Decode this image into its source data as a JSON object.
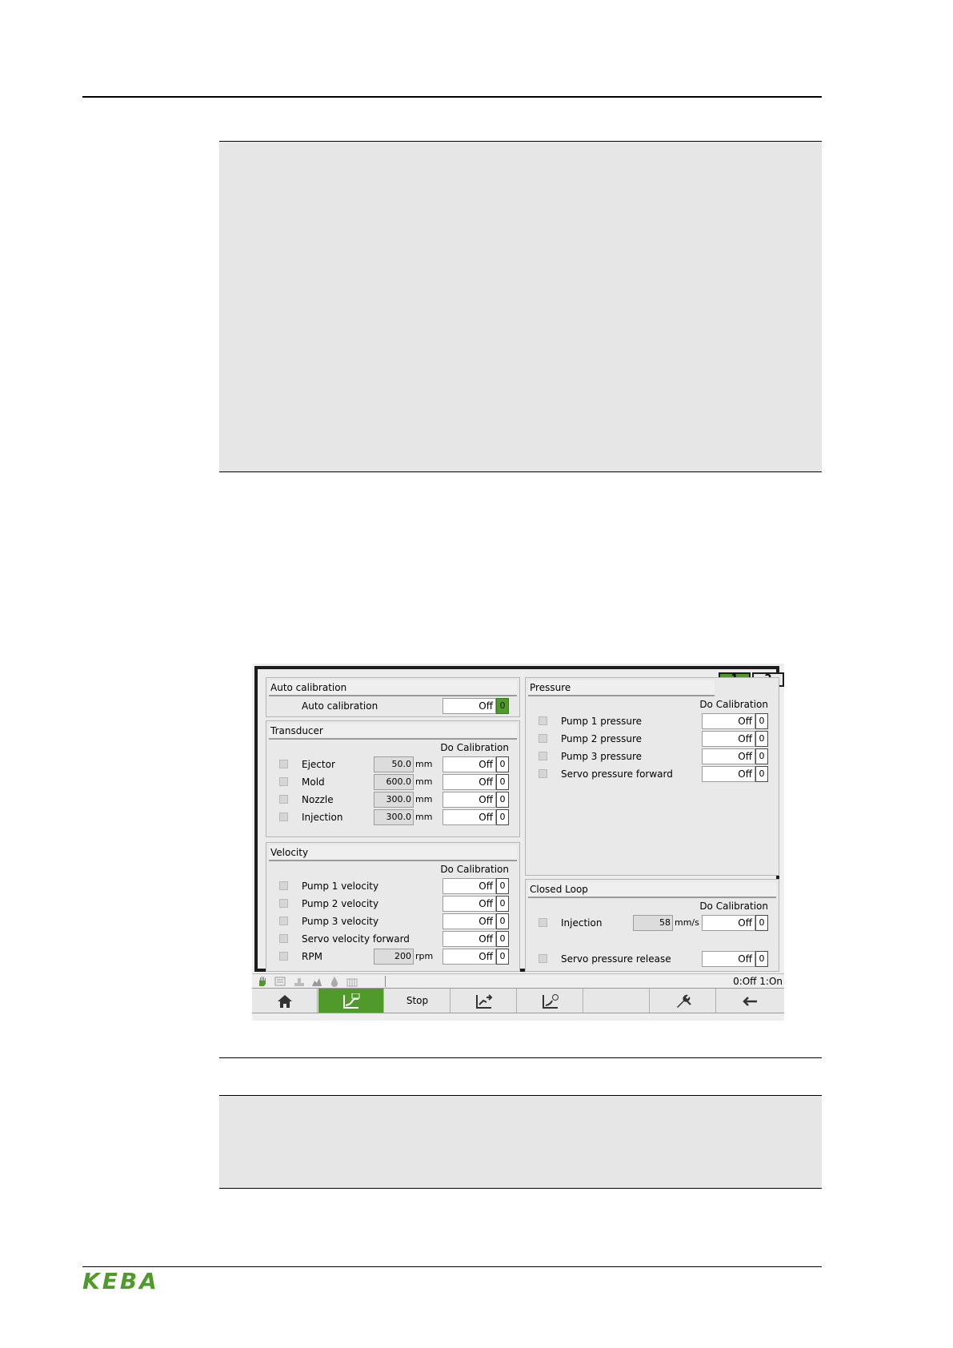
{
  "screen": {
    "tabs": [
      "1",
      "2"
    ],
    "auto_calibration": {
      "title": "Auto calibration",
      "label": "Auto calibration",
      "state": "Off",
      "code": "0"
    },
    "transducer": {
      "title": "Transducer",
      "header": "Do Calibration",
      "rows": [
        {
          "label": "Ejector",
          "value": "50.0",
          "unit": "mm",
          "state": "Off",
          "code": "0"
        },
        {
          "label": "Mold",
          "value": "600.0",
          "unit": "mm",
          "state": "Off",
          "code": "0"
        },
        {
          "label": "Nozzle",
          "value": "300.0",
          "unit": "mm",
          "state": "Off",
          "code": "0"
        },
        {
          "label": "Injection",
          "value": "300.0",
          "unit": "mm",
          "state": "Off",
          "code": "0"
        }
      ]
    },
    "velocity": {
      "title": "Velocity",
      "header": "Do Calibration",
      "rows": [
        {
          "label": "Pump 1 velocity",
          "state": "Off",
          "code": "0"
        },
        {
          "label": "Pump 2 velocity",
          "state": "Off",
          "code": "0"
        },
        {
          "label": "Pump 3 velocity",
          "state": "Off",
          "code": "0"
        },
        {
          "label": "Servo velocity forward",
          "state": "Off",
          "code": "0"
        },
        {
          "label": "RPM",
          "value": "200",
          "unit": "rpm",
          "state": "Off",
          "code": "0"
        }
      ]
    },
    "pressure": {
      "title": "Pressure",
      "header": "Do Calibration",
      "rows": [
        {
          "label": "Pump 1 pressure",
          "state": "Off",
          "code": "0"
        },
        {
          "label": "Pump 2 pressure",
          "state": "Off",
          "code": "0"
        },
        {
          "label": "Pump 3 pressure",
          "state": "Off",
          "code": "0"
        },
        {
          "label": "Servo pressure forward",
          "state": "Off",
          "code": "0"
        }
      ]
    },
    "closed_loop": {
      "title": "Closed Loop",
      "header": "Do Calibration",
      "rows": [
        {
          "label": "Injection",
          "value": "58",
          "unit": "mm/s",
          "state": "Off",
          "code": "0"
        },
        {
          "label": "Servo pressure release",
          "state": "Off",
          "code": "0"
        }
      ]
    },
    "status_text": "0:Off 1:On",
    "status_icons": [
      "hand-icon",
      "list-icon",
      "mold-icon",
      "chart-icon",
      "drop-icon",
      "heater-icon"
    ],
    "softkeys": [
      {
        "icon": "home-icon",
        "label": ""
      },
      {
        "icon": "auto-calibration-icon",
        "label": ""
      },
      {
        "icon": "",
        "label": "Stop"
      },
      {
        "icon": "curve-out-icon",
        "label": ""
      },
      {
        "icon": "curve-timer-icon",
        "label": ""
      },
      {
        "icon": "",
        "label": ""
      },
      {
        "icon": "wrench-icon",
        "label": ""
      },
      {
        "icon": "back-arrow-icon",
        "label": ""
      }
    ]
  },
  "footer": {
    "logo": "KEBA"
  },
  "colors": {
    "accent_green": "#4f9a2a",
    "frame": "#1c1c1c",
    "note_bg": "#e6e6e6"
  }
}
